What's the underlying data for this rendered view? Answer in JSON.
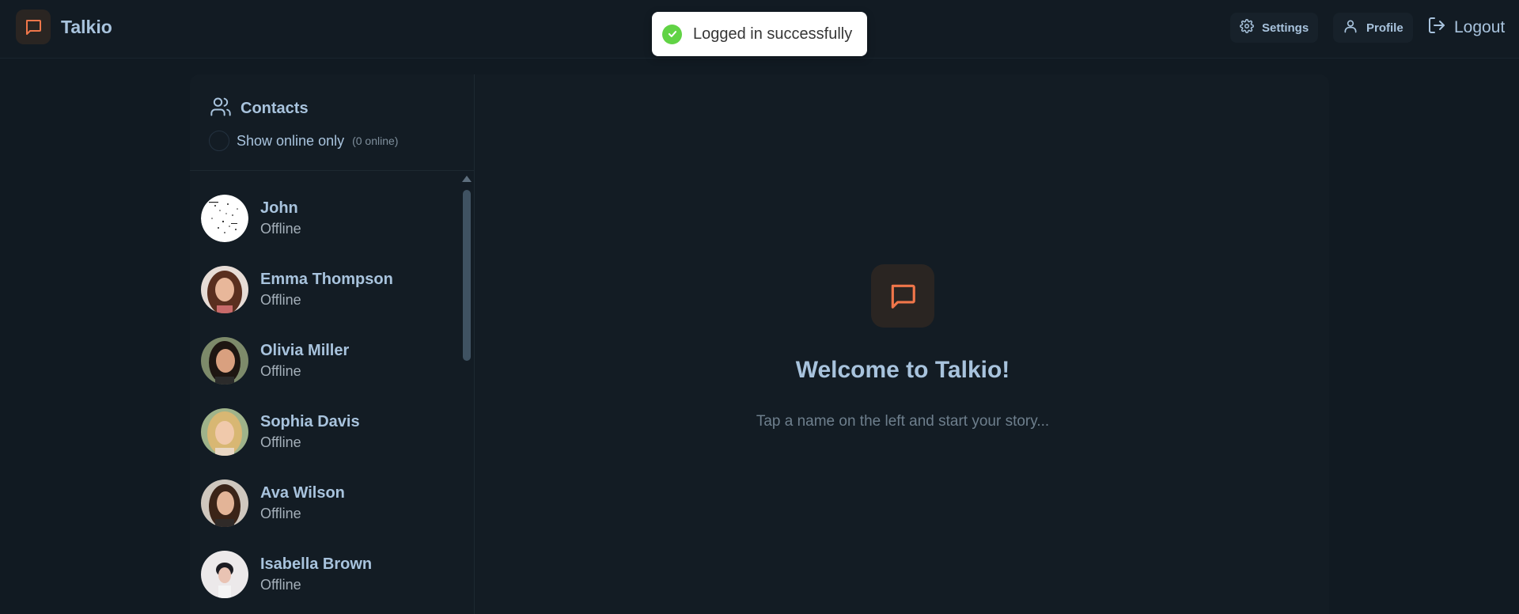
{
  "app": {
    "name": "Talkio",
    "accent": "#f0764a"
  },
  "header": {
    "settings_label": "Settings",
    "profile_label": "Profile",
    "logout_label": "Logout"
  },
  "toast": {
    "message": "Logged in successfully",
    "color": "#61d345"
  },
  "sidebar": {
    "title": "Contacts",
    "filter_label": "Show online only",
    "online_count": "(0 online)",
    "contacts": [
      {
        "name": "John",
        "status": "Offline"
      },
      {
        "name": "Emma Thompson",
        "status": "Offline"
      },
      {
        "name": "Olivia Miller",
        "status": "Offline"
      },
      {
        "name": "Sophia Davis",
        "status": "Offline"
      },
      {
        "name": "Ava Wilson",
        "status": "Offline"
      },
      {
        "name": "Isabella Brown",
        "status": "Offline"
      }
    ]
  },
  "welcome": {
    "title": "Welcome to Talkio!",
    "subtitle": "Tap a name on the left and start your story..."
  }
}
